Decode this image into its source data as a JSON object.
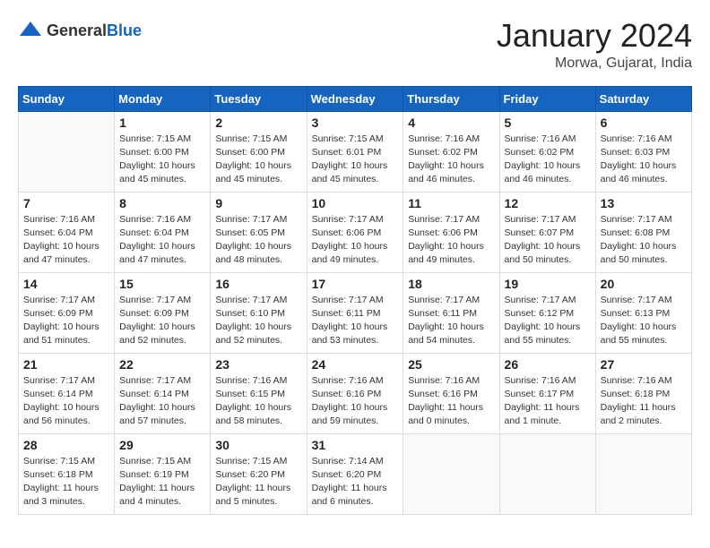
{
  "logo": {
    "general": "General",
    "blue": "Blue"
  },
  "title": "January 2024",
  "location": "Morwa, Gujarat, India",
  "weekdays": [
    "Sunday",
    "Monday",
    "Tuesday",
    "Wednesday",
    "Thursday",
    "Friday",
    "Saturday"
  ],
  "weeks": [
    [
      {
        "day": "",
        "info": ""
      },
      {
        "day": "1",
        "info": "Sunrise: 7:15 AM\nSunset: 6:00 PM\nDaylight: 10 hours\nand 45 minutes."
      },
      {
        "day": "2",
        "info": "Sunrise: 7:15 AM\nSunset: 6:00 PM\nDaylight: 10 hours\nand 45 minutes."
      },
      {
        "day": "3",
        "info": "Sunrise: 7:15 AM\nSunset: 6:01 PM\nDaylight: 10 hours\nand 45 minutes."
      },
      {
        "day": "4",
        "info": "Sunrise: 7:16 AM\nSunset: 6:02 PM\nDaylight: 10 hours\nand 46 minutes."
      },
      {
        "day": "5",
        "info": "Sunrise: 7:16 AM\nSunset: 6:02 PM\nDaylight: 10 hours\nand 46 minutes."
      },
      {
        "day": "6",
        "info": "Sunrise: 7:16 AM\nSunset: 6:03 PM\nDaylight: 10 hours\nand 46 minutes."
      }
    ],
    [
      {
        "day": "7",
        "info": "Sunrise: 7:16 AM\nSunset: 6:04 PM\nDaylight: 10 hours\nand 47 minutes."
      },
      {
        "day": "8",
        "info": "Sunrise: 7:16 AM\nSunset: 6:04 PM\nDaylight: 10 hours\nand 47 minutes."
      },
      {
        "day": "9",
        "info": "Sunrise: 7:17 AM\nSunset: 6:05 PM\nDaylight: 10 hours\nand 48 minutes."
      },
      {
        "day": "10",
        "info": "Sunrise: 7:17 AM\nSunset: 6:06 PM\nDaylight: 10 hours\nand 49 minutes."
      },
      {
        "day": "11",
        "info": "Sunrise: 7:17 AM\nSunset: 6:06 PM\nDaylight: 10 hours\nand 49 minutes."
      },
      {
        "day": "12",
        "info": "Sunrise: 7:17 AM\nSunset: 6:07 PM\nDaylight: 10 hours\nand 50 minutes."
      },
      {
        "day": "13",
        "info": "Sunrise: 7:17 AM\nSunset: 6:08 PM\nDaylight: 10 hours\nand 50 minutes."
      }
    ],
    [
      {
        "day": "14",
        "info": "Sunrise: 7:17 AM\nSunset: 6:09 PM\nDaylight: 10 hours\nand 51 minutes."
      },
      {
        "day": "15",
        "info": "Sunrise: 7:17 AM\nSunset: 6:09 PM\nDaylight: 10 hours\nand 52 minutes."
      },
      {
        "day": "16",
        "info": "Sunrise: 7:17 AM\nSunset: 6:10 PM\nDaylight: 10 hours\nand 52 minutes."
      },
      {
        "day": "17",
        "info": "Sunrise: 7:17 AM\nSunset: 6:11 PM\nDaylight: 10 hours\nand 53 minutes."
      },
      {
        "day": "18",
        "info": "Sunrise: 7:17 AM\nSunset: 6:11 PM\nDaylight: 10 hours\nand 54 minutes."
      },
      {
        "day": "19",
        "info": "Sunrise: 7:17 AM\nSunset: 6:12 PM\nDaylight: 10 hours\nand 55 minutes."
      },
      {
        "day": "20",
        "info": "Sunrise: 7:17 AM\nSunset: 6:13 PM\nDaylight: 10 hours\nand 55 minutes."
      }
    ],
    [
      {
        "day": "21",
        "info": "Sunrise: 7:17 AM\nSunset: 6:14 PM\nDaylight: 10 hours\nand 56 minutes."
      },
      {
        "day": "22",
        "info": "Sunrise: 7:17 AM\nSunset: 6:14 PM\nDaylight: 10 hours\nand 57 minutes."
      },
      {
        "day": "23",
        "info": "Sunrise: 7:16 AM\nSunset: 6:15 PM\nDaylight: 10 hours\nand 58 minutes."
      },
      {
        "day": "24",
        "info": "Sunrise: 7:16 AM\nSunset: 6:16 PM\nDaylight: 10 hours\nand 59 minutes."
      },
      {
        "day": "25",
        "info": "Sunrise: 7:16 AM\nSunset: 6:16 PM\nDaylight: 11 hours\nand 0 minutes."
      },
      {
        "day": "26",
        "info": "Sunrise: 7:16 AM\nSunset: 6:17 PM\nDaylight: 11 hours\nand 1 minute."
      },
      {
        "day": "27",
        "info": "Sunrise: 7:16 AM\nSunset: 6:18 PM\nDaylight: 11 hours\nand 2 minutes."
      }
    ],
    [
      {
        "day": "28",
        "info": "Sunrise: 7:15 AM\nSunset: 6:18 PM\nDaylight: 11 hours\nand 3 minutes."
      },
      {
        "day": "29",
        "info": "Sunrise: 7:15 AM\nSunset: 6:19 PM\nDaylight: 11 hours\nand 4 minutes."
      },
      {
        "day": "30",
        "info": "Sunrise: 7:15 AM\nSunset: 6:20 PM\nDaylight: 11 hours\nand 5 minutes."
      },
      {
        "day": "31",
        "info": "Sunrise: 7:14 AM\nSunset: 6:20 PM\nDaylight: 11 hours\nand 6 minutes."
      },
      {
        "day": "",
        "info": ""
      },
      {
        "day": "",
        "info": ""
      },
      {
        "day": "",
        "info": ""
      }
    ]
  ]
}
